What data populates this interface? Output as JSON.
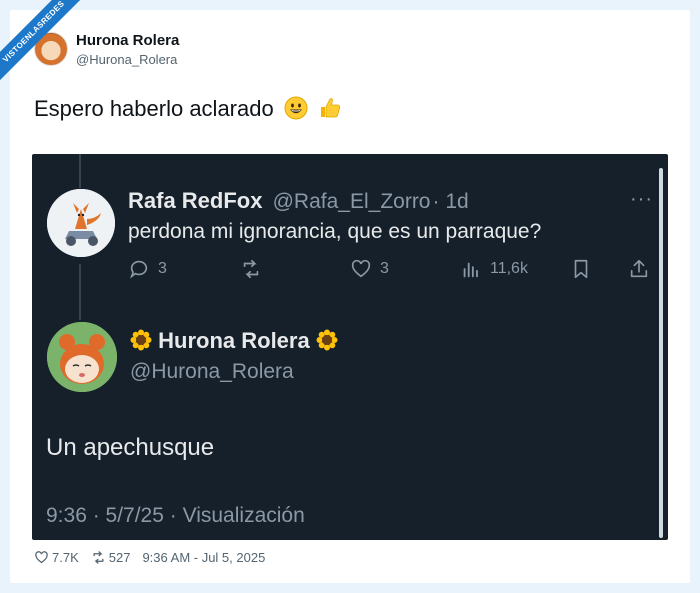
{
  "watermark": "VISTOENLASREDES",
  "post": {
    "author_name": "Hurona Rolera",
    "author_handle": "@Hurona_Rolera",
    "text": "Espero haberlo aclarado",
    "likes": "7.7K",
    "retweets": "527",
    "timestamp": "9:36 AM - Jul 5, 2025"
  },
  "screenshot": {
    "reply_to": {
      "name": "Rafa RedFox",
      "handle": "@Rafa_El_Zorro",
      "age": "· 1d",
      "more": "···",
      "text": "perdona mi ignorancia, que es un parraque?",
      "replies": "3",
      "likes": "3",
      "views": "11,6k"
    },
    "reply": {
      "name": "Hurona Rolera",
      "handle": "@Hurona_Rolera",
      "text": "Un apechusque",
      "meta": "9:36 · 5/7/25 · Visualización"
    }
  },
  "colors": {
    "dark_bg": "#15202b",
    "dark_text": "#e7e9ea",
    "dark_muted": "#8b98a5",
    "light_muted": "#536471"
  }
}
